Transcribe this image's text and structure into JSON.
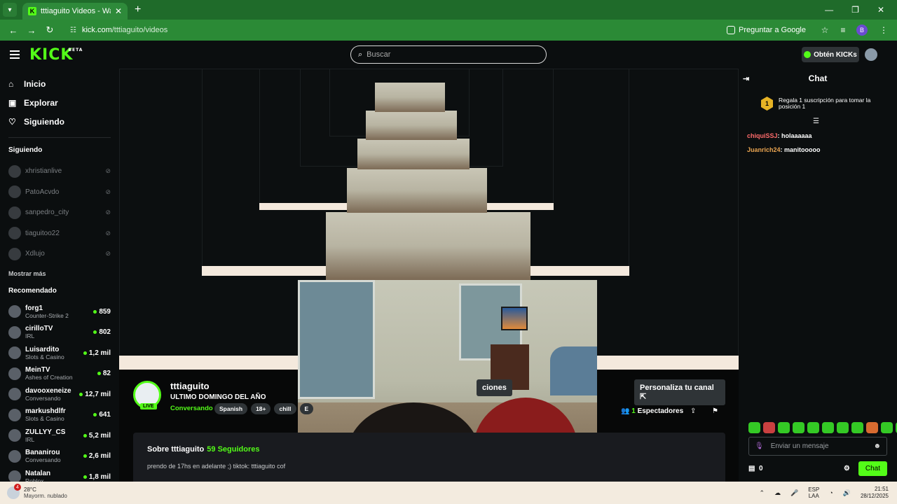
{
  "browser": {
    "tab_title": "tttiaguito Videos - Watch On-D",
    "url_domain": "kick.com",
    "url_path": "/tttiaguito/videos",
    "ask_google": "Preguntar a Google",
    "profile_initial": "B"
  },
  "kick": {
    "logo": "KICK",
    "logo_badge": "BETA",
    "search_placeholder": "Buscar",
    "kicks_button": "Obtén KICKs",
    "accent": "#53fc18"
  },
  "sidebar": {
    "nav": [
      {
        "label": "Inicio",
        "icon": "home-icon"
      },
      {
        "label": "Explorar",
        "icon": "compass-icon"
      },
      {
        "label": "Siguiendo",
        "icon": "heart-icon"
      }
    ],
    "following_title": "Siguiendo",
    "following": [
      "xhristianlive",
      "PatoAcvdo",
      "sanpedro_city",
      "tiaguitoo22",
      "Xdlujo"
    ],
    "show_more": "Mostrar más",
    "recommended_title": "Recomendado",
    "recommended": [
      {
        "name": "forg1",
        "category": "Counter-Strike 2",
        "viewers": "859"
      },
      {
        "name": "cirilloTV",
        "category": "IRL",
        "viewers": "802"
      },
      {
        "name": "Luisardito",
        "category": "Slots & Casino",
        "viewers": "1,2 mil"
      },
      {
        "name": "MeinTV",
        "category": "Ashes of Creation",
        "viewers": "82"
      },
      {
        "name": "davooxeneize",
        "category": "Conversando",
        "viewers": "12,7 mil"
      },
      {
        "name": "markushdlfr",
        "category": "Slots & Casino",
        "viewers": "641"
      },
      {
        "name": "ZULLYY_CS",
        "category": "IRL",
        "viewers": "5,2 mil"
      },
      {
        "name": "Bananirou",
        "category": "Conversando",
        "viewers": "2,6 mil"
      },
      {
        "name": "Natalan",
        "category": "Roblox",
        "viewers": "1,8 mil"
      }
    ]
  },
  "stream": {
    "live_badge": "LIVE",
    "channel": "tttiaguito",
    "title": "ULTIMO DOMINGO DEL AÑO",
    "category": "Conversando",
    "tags": [
      "Spanish",
      "18+",
      "chill",
      "E"
    ],
    "btn_sub_partial": "ciones",
    "btn_customize": "Personaliza tu canal",
    "viewers_count": "1",
    "viewers_label": "Espectadores",
    "about_title": "Sobre tttiaguito",
    "followers": "59 Seguidores",
    "description": "prendo de 17hs en adelante ;) tiktok: tttiaguito cof"
  },
  "chat": {
    "title": "Chat",
    "pinned": "Regala 1 suscripción para tomar la posición 1",
    "rank": "1",
    "messages": [
      {
        "user": "chiquiSSJ",
        "text": ": holaaaaaa"
      },
      {
        "user": "Juanrich24",
        "text": ": manitooooo"
      }
    ],
    "input_placeholder": "Enviar un mensaje",
    "points": "0",
    "send_label": "Chat"
  },
  "taskbar": {
    "notif_count": "4",
    "temp": "28°C",
    "weather": "Mayorm. nublado",
    "lang1": "ESP",
    "lang2": "LAA",
    "time": "21:51",
    "date": "28/12/2025"
  }
}
